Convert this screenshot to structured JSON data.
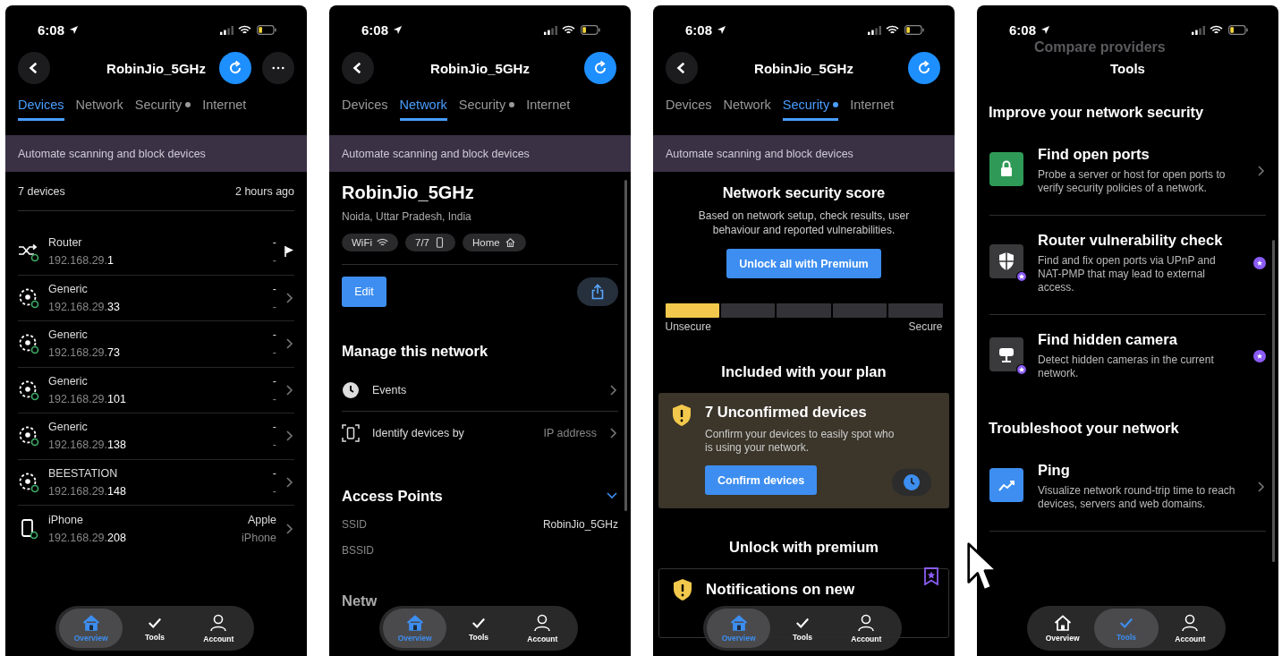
{
  "phones": [
    {
      "kind": "devices",
      "status": {
        "time": "6:08"
      },
      "header": {
        "title": "RobinJio_5GHz",
        "back": true,
        "refresh": true,
        "more": true
      },
      "tabs": [
        {
          "label": "Devices",
          "selected": true,
          "dot": false
        },
        {
          "label": "Network",
          "selected": false,
          "dot": false
        },
        {
          "label": "Security",
          "selected": false,
          "dot": true
        },
        {
          "label": "Internet",
          "selected": false,
          "dot": false
        }
      ],
      "banner": "Automate scanning and block devices",
      "summary": {
        "count": "7 devices",
        "updated": "2 hours ago"
      },
      "devices": [
        {
          "kind": "router",
          "name": "Router",
          "ip": "192.168.29.**1**",
          "vendor": "-",
          "model": "-"
        },
        {
          "kind": "generic",
          "name": "Generic",
          "ip": "192.168.29.**33**",
          "vendor": "-",
          "model": "-"
        },
        {
          "kind": "generic",
          "name": "Generic",
          "ip": "192.168.29.**73**",
          "vendor": "-",
          "model": "-"
        },
        {
          "kind": "generic",
          "name": "Generic",
          "ip": "192.168.29.**101**",
          "vendor": "-",
          "model": "-"
        },
        {
          "kind": "generic",
          "name": "Generic",
          "ip": "192.168.29.**138**",
          "vendor": "-",
          "model": "-"
        },
        {
          "kind": "generic",
          "name": "BEESTATION",
          "ip": "192.168.29.**148**",
          "vendor": "-",
          "model": "-"
        },
        {
          "kind": "phone",
          "name": "iPhone",
          "ip": "192.168.29.**208**",
          "vendor": "Apple",
          "model": "iPhone"
        }
      ],
      "nav": [
        {
          "kind": "home",
          "label": "Overview",
          "selected": true
        },
        {
          "kind": "check",
          "label": "Tools",
          "selected": false
        },
        {
          "kind": "person",
          "label": "Account",
          "selected": false
        }
      ]
    },
    {
      "kind": "network",
      "status": {
        "time": "6:08"
      },
      "header": {
        "title": "RobinJio_5GHz",
        "back": true,
        "refresh": true,
        "more": false
      },
      "tabs": [
        {
          "label": "Devices",
          "selected": false,
          "dot": false
        },
        {
          "label": "Network",
          "selected": true,
          "dot": false
        },
        {
          "label": "Security",
          "selected": false,
          "dot": true
        },
        {
          "label": "Internet",
          "selected": false,
          "dot": false
        }
      ],
      "banner": "Automate scanning and block devices",
      "network": {
        "name": "RobinJio_5GHz",
        "location": "Noida, Uttar Pradesh, India",
        "chips": [
          {
            "kind": "wifi",
            "label": "WiFi"
          },
          {
            "kind": "phone",
            "label": "7/7"
          },
          {
            "kind": "home",
            "label": "Home"
          }
        ],
        "edit": "Edit",
        "manage_title": "Manage this network",
        "rows": [
          {
            "kind": "clock",
            "label": "Events"
          },
          {
            "kind": "identify",
            "label": "Identify devices by",
            "value": "IP address"
          }
        ],
        "access_title": "Access Points",
        "access_expanded": true,
        "fields": [
          {
            "label": "SSID",
            "value": "RobinJio_5GHz"
          },
          {
            "label": "BSSID"
          }
        ],
        "next_title": "Netw"
      },
      "nav": [
        {
          "kind": "home",
          "label": "Overview",
          "selected": true
        },
        {
          "kind": "check",
          "label": "Tools",
          "selected": false
        },
        {
          "kind": "person",
          "label": "Account",
          "selected": false
        }
      ]
    },
    {
      "kind": "security",
      "status": {
        "time": "6:08"
      },
      "header": {
        "title": "RobinJio_5GHz",
        "back": true,
        "refresh": true,
        "more": false
      },
      "tabs": [
        {
          "label": "Devices",
          "selected": false,
          "dot": false
        },
        {
          "label": "Network",
          "selected": false,
          "dot": false
        },
        {
          "label": "Security",
          "selected": true,
          "dot": true
        },
        {
          "label": "Internet",
          "selected": false,
          "dot": false
        }
      ],
      "banner": "Automate scanning and block devices",
      "security": {
        "title": "Network security score",
        "description": "Based on network setup, check results, user behaviour and reported vulnerabilities.",
        "unlock_button": "Unlock all with Premium",
        "meter": {
          "level": 0.2,
          "low": "Unsecure",
          "high": "Secure"
        },
        "included_title": "Included with your plan",
        "alert": {
          "title": "7 Unconfirmed devices",
          "text": "Confirm your devices to easily spot who is using your network.",
          "button": "Confirm devices"
        },
        "premium_title": "Unlock with premium",
        "premium_card": {
          "title": "Notifications on new"
        }
      },
      "nav": [
        {
          "kind": "home",
          "label": "Overview",
          "selected": true
        },
        {
          "kind": "check",
          "label": "Tools",
          "selected": false
        },
        {
          "kind": "person",
          "label": "Account",
          "selected": false
        }
      ]
    },
    {
      "kind": "tools",
      "status": {
        "time": "6:08"
      },
      "header": {
        "title": "Tools",
        "back": false,
        "refresh": false,
        "more": false,
        "faded_item": "Compare providers"
      },
      "sections": [
        {
          "title": "Improve your network security",
          "items": [
            {
              "kind": "lock",
              "title": "Find open ports",
              "description": "Probe a server or host for open ports to verify security policies of a network.",
              "premium": false
            },
            {
              "kind": "shield",
              "title": "Router vulnerability check",
              "description": "Find and fix open ports via UPnP and NAT-PMP that may lead to external access.",
              "premium": true
            },
            {
              "kind": "camera",
              "title": "Find hidden camera",
              "description": "Detect hidden cameras in the current network.",
              "premium": true
            }
          ]
        },
        {
          "title": "Troubleshoot your network",
          "items": [
            {
              "kind": "chart",
              "title": "Ping",
              "description": "Visualize network round-trip time to reach devices, servers and web domains.",
              "premium": false
            }
          ]
        }
      ],
      "nav": [
        {
          "kind": "home",
          "label": "Overview",
          "selected": false
        },
        {
          "kind": "check",
          "label": "Tools",
          "selected": true
        },
        {
          "kind": "person",
          "label": "Account",
          "selected": false
        }
      ]
    }
  ]
}
